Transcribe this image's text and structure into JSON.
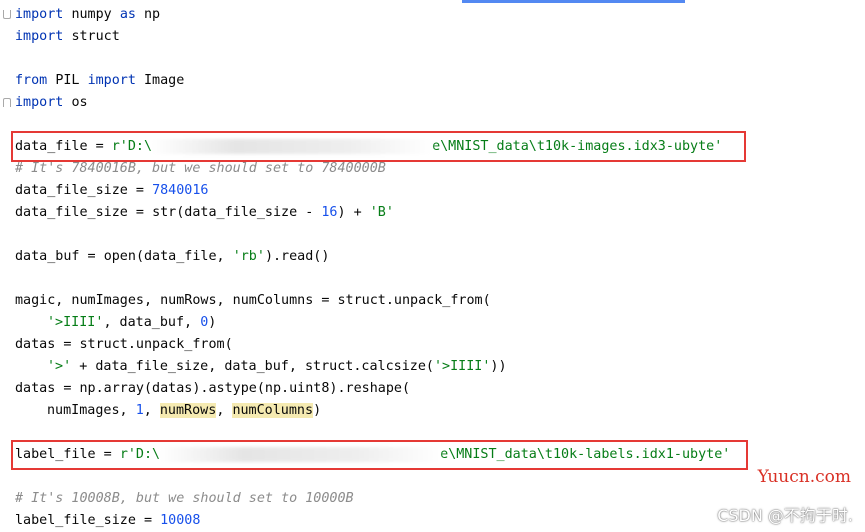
{
  "code": {
    "line1": {
      "kw_import": "import",
      "module": "numpy",
      "kw_as": "as",
      "alias": "np"
    },
    "line2": {
      "kw_import": "import",
      "module": "struct"
    },
    "line3": {
      "kw_from": "from",
      "module": "PIL",
      "kw_import": "import",
      "name": "Image"
    },
    "line4": {
      "kw_import": "import",
      "module": "os"
    },
    "line5": {
      "var": "data_file",
      "eq": " = ",
      "str_prefix": "r'D:\\",
      "str_suffix": "e\\MNIST_data\\t10k-images.idx3-ubyte'"
    },
    "line6": {
      "comment": "# It's 7840016B, but we should set to 7840000B"
    },
    "line7": {
      "var": "data_file_size",
      "eq": " = ",
      "value": "7840016"
    },
    "line8": {
      "lhs": "data_file_size = ",
      "fn": "str",
      "mid": "(data_file_size - ",
      "num": "16",
      "close": ") + ",
      "str": "'B'"
    },
    "line9": {
      "lhs": "data_buf = ",
      "fn": "open",
      "mid": "(data_file, ",
      "str": "'rb'",
      "tail": ").read()"
    },
    "line10": {
      "text": "magic, numImages, numRows, numColumns = struct.unpack_from("
    },
    "line11": {
      "str": "'>IIII'",
      "mid": ", data_buf, ",
      "num": "0",
      "tail": ")"
    },
    "line12": {
      "text": "datas = struct.unpack_from("
    },
    "line13": {
      "str1": "'>'",
      "mid": " + data_file_size, data_buf, struct.calcsize(",
      "str2": "'>IIII'",
      "tail": "))"
    },
    "line14": {
      "text": "datas = np.array(datas).astype(np.uint8).reshape("
    },
    "line15": {
      "a": "numImages, ",
      "num": "1",
      "sep": ", ",
      "hl1": "numRows",
      "sep2": ", ",
      "hl2": "numColumns",
      "tail": ")"
    },
    "line16": {
      "var": "label_file",
      "eq": " = ",
      "str_prefix": "r'D:\\",
      "str_suffix": "e\\MNIST_data\\t10k-labels.idx1-ubyte'"
    },
    "line17": {
      "comment": "# It's 10008B, but we should set to 10000B"
    },
    "line18": {
      "var": "label_file_size",
      "eq": " = ",
      "value": "10008"
    }
  },
  "watermarks": {
    "brand": "Yuucn.com",
    "csdn": "CSDN @不拘于时."
  },
  "colors": {
    "keyword": "#0033b3",
    "string": "#067d17",
    "number": "#1750eb",
    "comment": "#8c8c8c",
    "highlight_box": "#e53935",
    "usage_highlight": "#f5eab1"
  }
}
